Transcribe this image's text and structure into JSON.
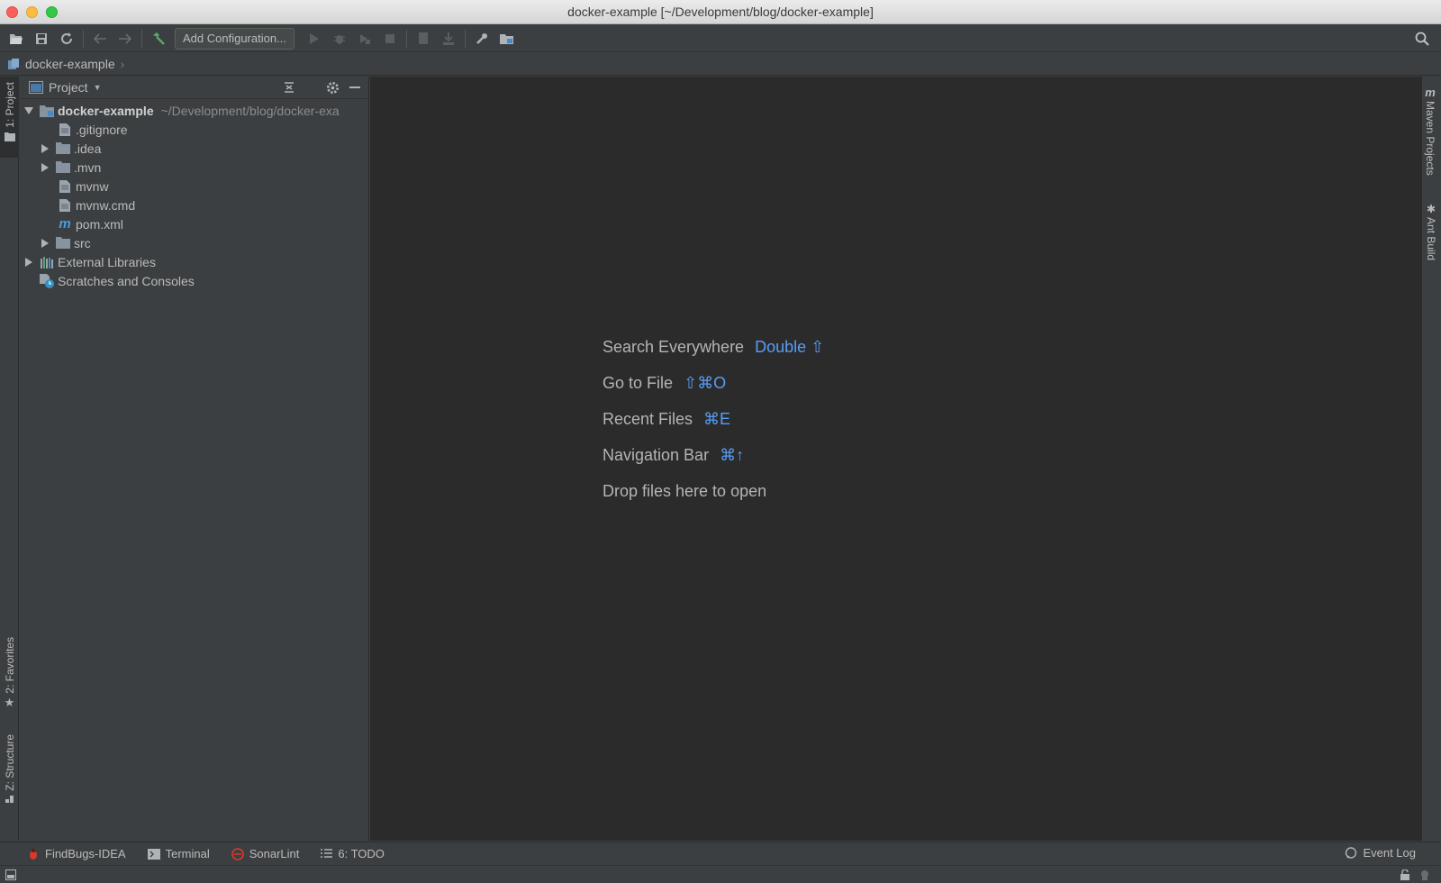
{
  "window": {
    "title": "docker-example [~/Development/blog/docker-example]"
  },
  "toolbar": {
    "add_configuration_label": "Add Configuration..."
  },
  "navbar": {
    "project_label": "docker-example"
  },
  "left_strip": {
    "project_tab": "1: Project",
    "favorites_tab": "2: Favorites",
    "structure_tab": "Z: Structure"
  },
  "right_strip": {
    "maven_tab": "Maven Projects",
    "ant_tab": "Ant Build"
  },
  "project_panel": {
    "title": "Project",
    "root": {
      "name": "docker-example",
      "path": "~/Development/blog/docker-exa"
    },
    "items": [
      {
        "label": ".gitignore"
      },
      {
        "label": ".idea"
      },
      {
        "label": ".mvn"
      },
      {
        "label": "mvnw"
      },
      {
        "label": "mvnw.cmd"
      },
      {
        "label": "pom.xml"
      },
      {
        "label": "src"
      },
      {
        "label": "External Libraries"
      },
      {
        "label": "Scratches and Consoles"
      }
    ]
  },
  "editor": {
    "hints": [
      {
        "label": "Search Everywhere",
        "shortcut": "Double ⇧"
      },
      {
        "label": "Go to File",
        "shortcut": "⇧⌘O"
      },
      {
        "label": "Recent Files",
        "shortcut": "⌘E"
      },
      {
        "label": "Navigation Bar",
        "shortcut": "⌘↑"
      },
      {
        "label": "Drop files here to open",
        "shortcut": ""
      }
    ]
  },
  "bottom_bar": {
    "findbugs": "FindBugs-IDEA",
    "terminal": "Terminal",
    "sonarlint": "SonarLint",
    "todo": "6: TODO",
    "event_log": "Event Log"
  },
  "colors": {
    "editor_bg": "#2b2b2b",
    "panel_bg": "#3c3f41",
    "shortcut": "#589df6"
  }
}
